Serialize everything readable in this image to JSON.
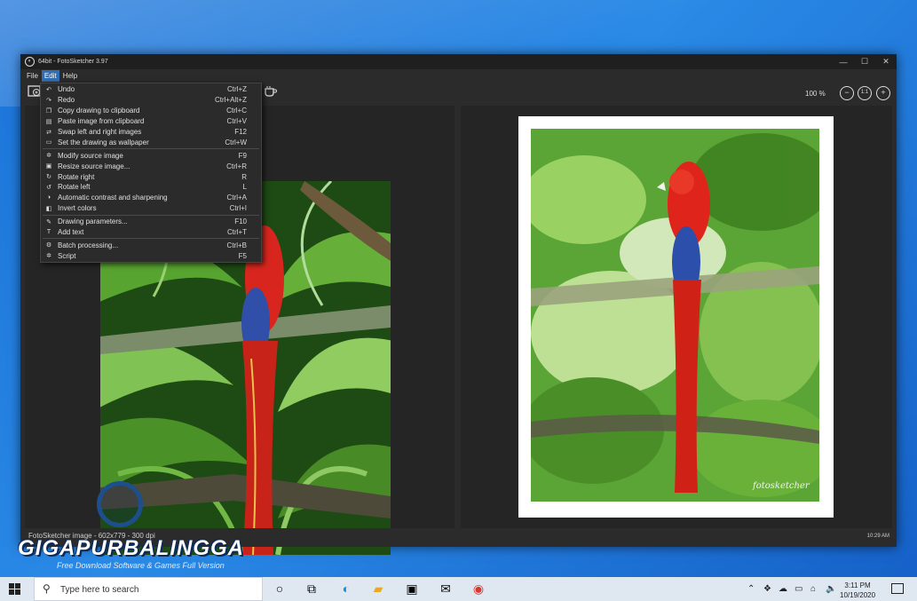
{
  "window": {
    "title": "64bit - FotoSketcher 3.97",
    "controls": {
      "minimize": "—",
      "maximize": "☐",
      "close": "✕"
    }
  },
  "menubar": {
    "file": "File",
    "edit": "Edit",
    "help": "Help"
  },
  "toolbar": {
    "zoom_level": "100 %",
    "zoom_reset_label": "1:1"
  },
  "edit_menu": {
    "groups": [
      [
        {
          "label": "Undo",
          "shortcut": "Ctrl+Z",
          "icon": "undo-icon"
        },
        {
          "label": "Redo",
          "shortcut": "Ctrl+Alt+Z",
          "icon": "redo-icon"
        },
        {
          "label": "Copy drawing to clipboard",
          "shortcut": "Ctrl+C",
          "icon": "copy-icon"
        },
        {
          "label": "Paste image from clipboard",
          "shortcut": "Ctrl+V",
          "icon": "paste-icon"
        },
        {
          "label": "Swap left and right images",
          "shortcut": "F12",
          "icon": "swap-icon"
        },
        {
          "label": "Set the drawing as wallpaper",
          "shortcut": "Ctrl+W",
          "icon": "monitor-icon"
        }
      ],
      [
        {
          "label": "Modify source image",
          "shortcut": "F9",
          "icon": "gear-icon"
        },
        {
          "label": "Resize source image...",
          "shortcut": "Ctrl+R",
          "icon": "resize-icon"
        },
        {
          "label": "Rotate right",
          "shortcut": "R",
          "icon": "rotate-right-icon"
        },
        {
          "label": "Rotate left",
          "shortcut": "L",
          "icon": "rotate-left-icon"
        },
        {
          "label": "Automatic contrast and sharpening",
          "shortcut": "Ctrl+A",
          "icon": "contrast-icon"
        },
        {
          "label": "Invert colors",
          "shortcut": "Ctrl+I",
          "icon": "invert-icon"
        }
      ],
      [
        {
          "label": "Drawing parameters...",
          "shortcut": "F10",
          "icon": "brush-icon"
        },
        {
          "label": "Add text",
          "shortcut": "Ctrl+T",
          "icon": "text-icon"
        }
      ],
      [
        {
          "label": "Batch processing...",
          "shortcut": "Ctrl+B",
          "icon": "batch-icon"
        },
        {
          "label": "Script",
          "shortcut": "F5",
          "icon": "script-icon"
        }
      ]
    ]
  },
  "statusbar": {
    "info": "FotoSketcher image - 602x779 - 300 dpi",
    "clock": "10:29 AM"
  },
  "right_image": {
    "signature": "fotosketcher"
  },
  "watermark": {
    "title": "GIGAPURBALINGGA",
    "subtitle": "Free Download Software & Games Full Version"
  },
  "taskbar": {
    "search_placeholder": "Type here to search",
    "time": "3:11 PM",
    "date": "10/19/2020"
  },
  "colors": {
    "accent": "#2f6fb5",
    "parrot_red": "#d8261e",
    "parrot_blue": "#2f4fa8"
  }
}
